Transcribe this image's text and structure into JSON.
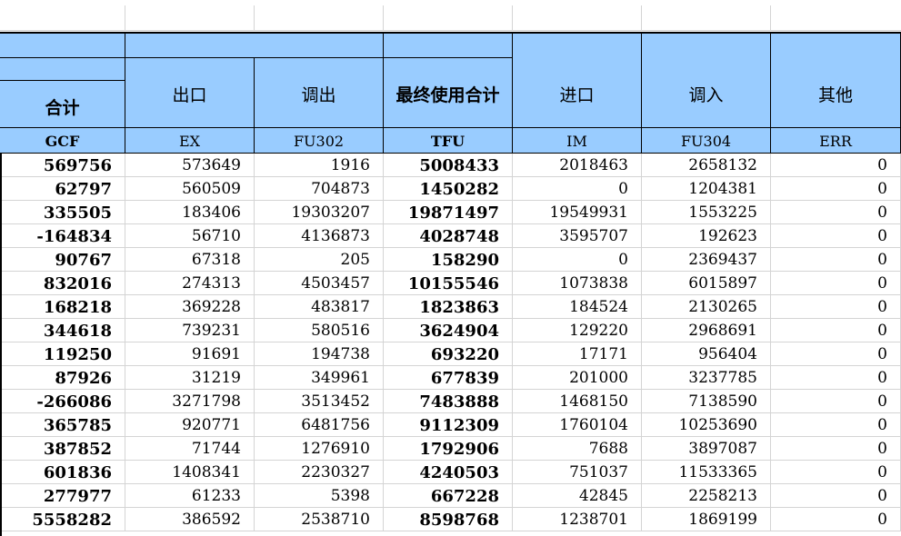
{
  "header": {
    "total_label": "合计",
    "export_label": "出口",
    "outflow_label": "调出",
    "final_use_label": "最终使用合计",
    "import_label": "进口",
    "inflow_label": "调入",
    "other_label": "其他"
  },
  "codes": [
    "GCF",
    "EX",
    "FU302",
    "TFU",
    "IM",
    "FU304",
    "ERR"
  ],
  "rows": [
    [
      "569756",
      "573649",
      "1916",
      "5008433",
      "2018463",
      "2658132",
      "0"
    ],
    [
      "62797",
      "560509",
      "704873",
      "1450282",
      "0",
      "1204381",
      "0"
    ],
    [
      "335505",
      "183406",
      "19303207",
      "19871497",
      "19549931",
      "1553225",
      "0"
    ],
    [
      "-164834",
      "56710",
      "4136873",
      "4028748",
      "3595707",
      "192623",
      "0"
    ],
    [
      "90767",
      "67318",
      "205",
      "158290",
      "0",
      "2369437",
      "0"
    ],
    [
      "832016",
      "274313",
      "4503457",
      "10155546",
      "1073838",
      "6015897",
      "0"
    ],
    [
      "168218",
      "369228",
      "483817",
      "1823863",
      "184524",
      "2130265",
      "0"
    ],
    [
      "344618",
      "739231",
      "580516",
      "3624904",
      "129220",
      "2968691",
      "0"
    ],
    [
      "119250",
      "91691",
      "194738",
      "693220",
      "17171",
      "956404",
      "0"
    ],
    [
      "87926",
      "31219",
      "349961",
      "677839",
      "201000",
      "3237785",
      "0"
    ],
    [
      "-266086",
      "3271798",
      "3513452",
      "7483888",
      "1468150",
      "7138590",
      "0"
    ],
    [
      "365785",
      "920771",
      "6481756",
      "9112309",
      "1760104",
      "10253690",
      "0"
    ],
    [
      "387852",
      "71744",
      "1276910",
      "1792906",
      "7688",
      "3897087",
      "0"
    ],
    [
      "601836",
      "1408341",
      "2230327",
      "4240503",
      "751037",
      "11533365",
      "0"
    ],
    [
      "277977",
      "61233",
      "5398",
      "667228",
      "42845",
      "2258213",
      "0"
    ],
    [
      "5558282",
      "386592",
      "2538710",
      "8598768",
      "1238701",
      "1869199",
      "0"
    ]
  ],
  "colors": {
    "header_bg": "#99ccff",
    "grid": "#d4d4d4",
    "border": "#000000"
  }
}
